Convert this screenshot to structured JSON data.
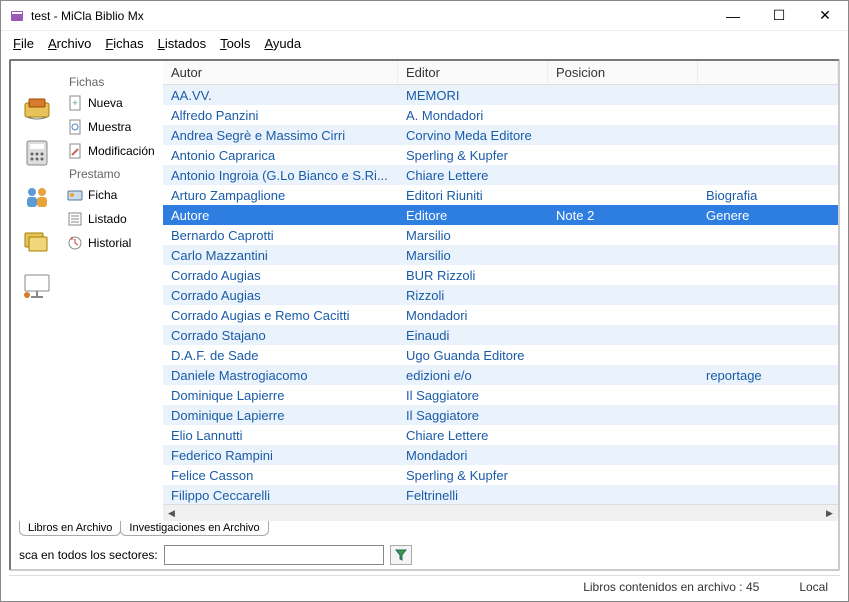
{
  "window": {
    "title": "test - MiCla Biblio Mx"
  },
  "titlebar_buttons": {
    "min": "—",
    "max": "☐",
    "close": "✕"
  },
  "menu": [
    "File",
    "Archivo",
    "Fichas",
    "Listados",
    "Tools",
    "Ayuda"
  ],
  "sidebar": {
    "fichas_header": "Fichas",
    "fichas_items": [
      {
        "label": "Nueva"
      },
      {
        "label": "Muestra"
      },
      {
        "label": "Modificación"
      }
    ],
    "prestamo_header": "Prestamo",
    "prestamo_items": [
      {
        "label": "Ficha"
      },
      {
        "label": "Listado"
      },
      {
        "label": "Historial"
      }
    ]
  },
  "columns": [
    "Autor",
    "Editor",
    "Posicion",
    ""
  ],
  "rows": [
    {
      "a": "AA.VV.",
      "e": "MEMORI",
      "p": "",
      "x": ""
    },
    {
      "a": "Alfredo Panzini",
      "e": "A. Mondadori",
      "p": "",
      "x": ""
    },
    {
      "a": "Andrea Segrè e Massimo Cirri",
      "e": "Corvino Meda Editore",
      "p": "",
      "x": ""
    },
    {
      "a": "Antonio Caprarica",
      "e": "Sperling & Kupfer",
      "p": "",
      "x": ""
    },
    {
      "a": "Antonio Ingroia (G.Lo Bianco e S.Ri...",
      "e": "Chiare Lettere",
      "p": "",
      "x": ""
    },
    {
      "a": "Arturo Zampaglione",
      "e": "Editori Riuniti",
      "p": "",
      "x": "Biografia"
    },
    {
      "a": "Autore",
      "e": "Editore",
      "p": "Note 2",
      "x": "Genere",
      "selected": true
    },
    {
      "a": "Bernardo Caprotti",
      "e": "Marsilio",
      "p": "",
      "x": ""
    },
    {
      "a": "Carlo Mazzantini",
      "e": "Marsilio",
      "p": "",
      "x": ""
    },
    {
      "a": "Corrado Augias",
      "e": "BUR Rizzoli",
      "p": "",
      "x": ""
    },
    {
      "a": "Corrado Augias",
      "e": "Rizzoli",
      "p": "",
      "x": ""
    },
    {
      "a": "Corrado Augias e Remo Cacitti",
      "e": "Mondadori",
      "p": "",
      "x": ""
    },
    {
      "a": "Corrado Stajano",
      "e": "Einaudi",
      "p": "",
      "x": ""
    },
    {
      "a": "D.A.F. de Sade",
      "e": "Ugo Guanda Editore",
      "p": "",
      "x": ""
    },
    {
      "a": "Daniele Mastrogiacomo",
      "e": "edizioni e/o",
      "p": "",
      "x": "reportage"
    },
    {
      "a": "Dominique Lapierre",
      "e": "Il Saggiatore",
      "p": "",
      "x": ""
    },
    {
      "a": "Dominique Lapierre",
      "e": "Il Saggiatore",
      "p": "",
      "x": ""
    },
    {
      "a": "Elio Lannutti",
      "e": "Chiare Lettere",
      "p": "",
      "x": ""
    },
    {
      "a": "Federico Rampini",
      "e": "Mondadori",
      "p": "",
      "x": ""
    },
    {
      "a": "Felice Casson",
      "e": "Sperling & Kupfer",
      "p": "",
      "x": ""
    },
    {
      "a": "Filippo Ceccarelli",
      "e": "Feltrinelli",
      "p": "",
      "x": ""
    }
  ],
  "tabs": [
    "Libros en Archivo",
    "Investigaciones en Archivo"
  ],
  "search": {
    "label": "sca en todos los sectores:",
    "placeholder": ""
  },
  "status": {
    "count": "Libros contenidos en archivo : 45",
    "mode": "Local"
  }
}
